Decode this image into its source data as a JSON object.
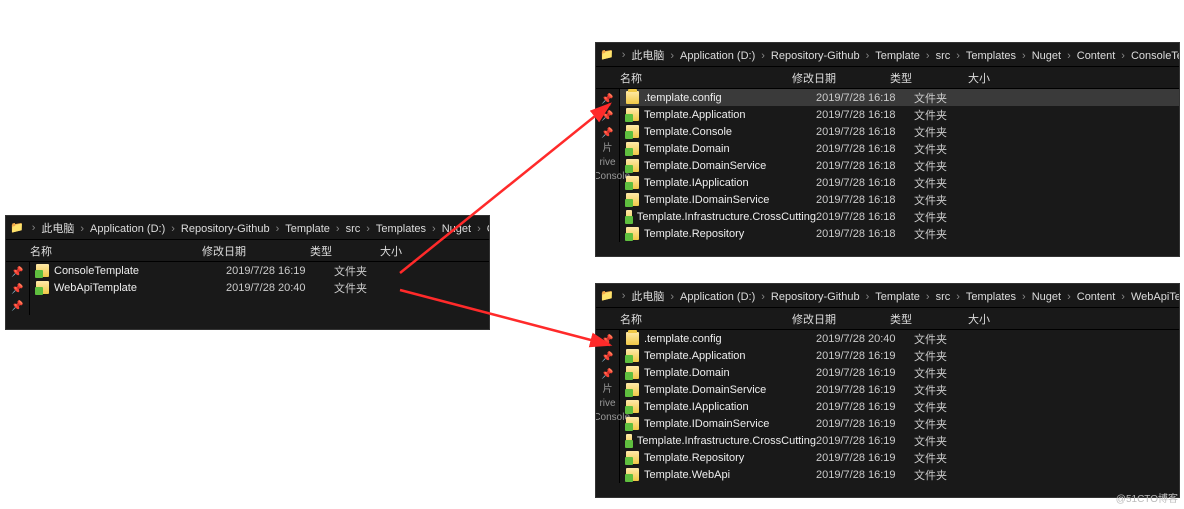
{
  "columns": {
    "name": "名称",
    "date": "修改日期",
    "type": "类型",
    "size": "大小"
  },
  "type_folder": "文件夹",
  "watermark": "@51CTO博客",
  "left": {
    "crumbs": [
      "此电脑",
      "Application (D:)",
      "Repository-Github",
      "Template",
      "src",
      "Templates",
      "Nuget",
      "Content"
    ],
    "pins": [
      "📌",
      "📌",
      "📌"
    ],
    "rows": [
      {
        "icon": "folder",
        "name": "ConsoleTemplate",
        "date": "2019/7/28 16:19"
      },
      {
        "icon": "folder",
        "name": "WebApiTemplate",
        "date": "2019/7/28 20:40"
      }
    ]
  },
  "top": {
    "crumbs": [
      "此电脑",
      "Application (D:)",
      "Repository-Github",
      "Template",
      "src",
      "Templates",
      "Nuget",
      "Content",
      "ConsoleTemplate"
    ],
    "pins": [
      "📌",
      "📌",
      "📌"
    ],
    "side_labels": [
      "片",
      "rive",
      "e.Console"
    ],
    "rows": [
      {
        "icon": "config",
        "name": ".template.config",
        "date": "2019/7/28 16:18",
        "sel": true
      },
      {
        "icon": "folder",
        "name": "Template.Application",
        "date": "2019/7/28 16:18"
      },
      {
        "icon": "folder",
        "name": "Template.Console",
        "date": "2019/7/28 16:18"
      },
      {
        "icon": "folder",
        "name": "Template.Domain",
        "date": "2019/7/28 16:18"
      },
      {
        "icon": "folder",
        "name": "Template.DomainService",
        "date": "2019/7/28 16:18"
      },
      {
        "icon": "folder",
        "name": "Template.IApplication",
        "date": "2019/7/28 16:18"
      },
      {
        "icon": "folder",
        "name": "Template.IDomainService",
        "date": "2019/7/28 16:18"
      },
      {
        "icon": "folder",
        "name": "Template.Infrastructure.CrossCutting",
        "date": "2019/7/28 16:18"
      },
      {
        "icon": "folder",
        "name": "Template.Repository",
        "date": "2019/7/28 16:18"
      }
    ]
  },
  "bottom": {
    "crumbs": [
      "此电脑",
      "Application (D:)",
      "Repository-Github",
      "Template",
      "src",
      "Templates",
      "Nuget",
      "Content",
      "WebApiTemplate"
    ],
    "pins": [
      "📌",
      "📌",
      "📌"
    ],
    "side_labels": [
      "片",
      "rive",
      "e.Console"
    ],
    "rows": [
      {
        "icon": "config",
        "name": ".template.config",
        "date": "2019/7/28 20:40"
      },
      {
        "icon": "folder",
        "name": "Template.Application",
        "date": "2019/7/28 16:19"
      },
      {
        "icon": "folder",
        "name": "Template.Domain",
        "date": "2019/7/28 16:19"
      },
      {
        "icon": "folder",
        "name": "Template.DomainService",
        "date": "2019/7/28 16:19"
      },
      {
        "icon": "folder",
        "name": "Template.IApplication",
        "date": "2019/7/28 16:19"
      },
      {
        "icon": "folder",
        "name": "Template.IDomainService",
        "date": "2019/7/28 16:19"
      },
      {
        "icon": "folder",
        "name": "Template.Infrastructure.CrossCutting",
        "date": "2019/7/28 16:19"
      },
      {
        "icon": "folder",
        "name": "Template.Repository",
        "date": "2019/7/28 16:19"
      },
      {
        "icon": "folder",
        "name": "Template.WebApi",
        "date": "2019/7/28 16:19"
      }
    ]
  }
}
